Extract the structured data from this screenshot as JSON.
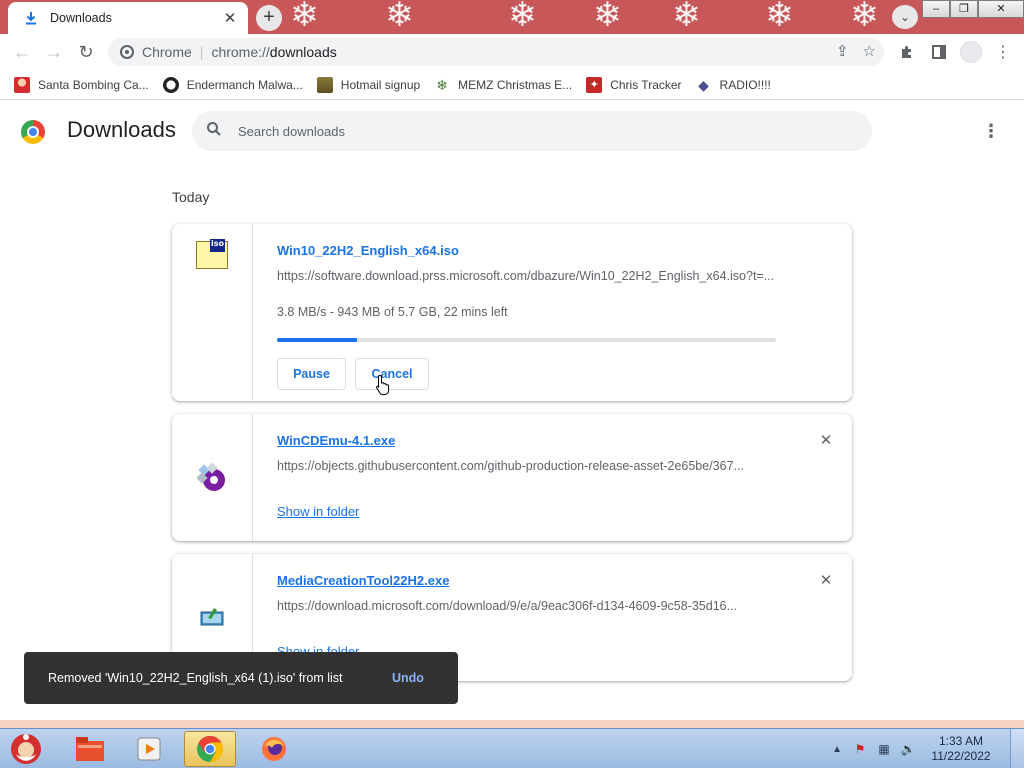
{
  "tab": {
    "title": "Downloads",
    "icon": "download-icon"
  },
  "window_controls": {
    "minimize": "–",
    "restore": "❐",
    "close": "✕"
  },
  "omnibox": {
    "scheme_label": "Chrome",
    "url_prefix": "chrome://",
    "url_path": "downloads"
  },
  "bookmarks": [
    {
      "label": "Santa Bombing Ca...",
      "icon": "santa-icon"
    },
    {
      "label": "Endermanch Malwa...",
      "icon": "panda-icon"
    },
    {
      "label": "Hotmail signup",
      "icon": "trophy-icon"
    },
    {
      "label": "MEMZ Christmas E...",
      "icon": "snowflake-icon"
    },
    {
      "label": "Chris Tracker",
      "icon": "red-star-icon"
    },
    {
      "label": "RADIO!!!!",
      "icon": "diamond-icon"
    }
  ],
  "page": {
    "title": "Downloads",
    "search_placeholder": "Search downloads",
    "section_label": "Today"
  },
  "downloads": [
    {
      "filename": "Win10_22H2_English_x64.iso",
      "url": "https://software.download.prss.microsoft.com/dbazure/Win10_22H2_English_x64.iso?t=...",
      "status": "3.8 MB/s - 943 MB of 5.7 GB, 22 mins left",
      "progress": 0.16,
      "pause_label": "Pause",
      "cancel_label": "Cancel",
      "icon": "iso-file-icon"
    },
    {
      "filename": "WinCDEmu-4.1.exe",
      "url": "https://objects.githubusercontent.com/github-production-release-asset-2e65be/367...",
      "link_label": "Show in folder",
      "icon": "wincdemu-icon"
    },
    {
      "filename": "MediaCreationTool22H2.exe",
      "url": "https://download.microsoft.com/download/9/e/a/9eac306f-d134-4609-9c58-35d16...",
      "link_label": "Show in folder",
      "icon": "media-creation-tool-icon"
    }
  ],
  "toast": {
    "message": "Removed 'Win10_22H2_English_x64 (1).iso' from list",
    "action": "Undo"
  },
  "taskbar": {
    "clock_time": "1:33 AM",
    "clock_date": "11/22/2022",
    "items": [
      "santa-start-icon",
      "file-explorer-icon",
      "media-player-icon",
      "chrome-icon",
      "firefox-icon"
    ]
  },
  "colors": {
    "accent": "#1a73e8",
    "tabbar": "#c8575a",
    "toast": "#323232"
  }
}
